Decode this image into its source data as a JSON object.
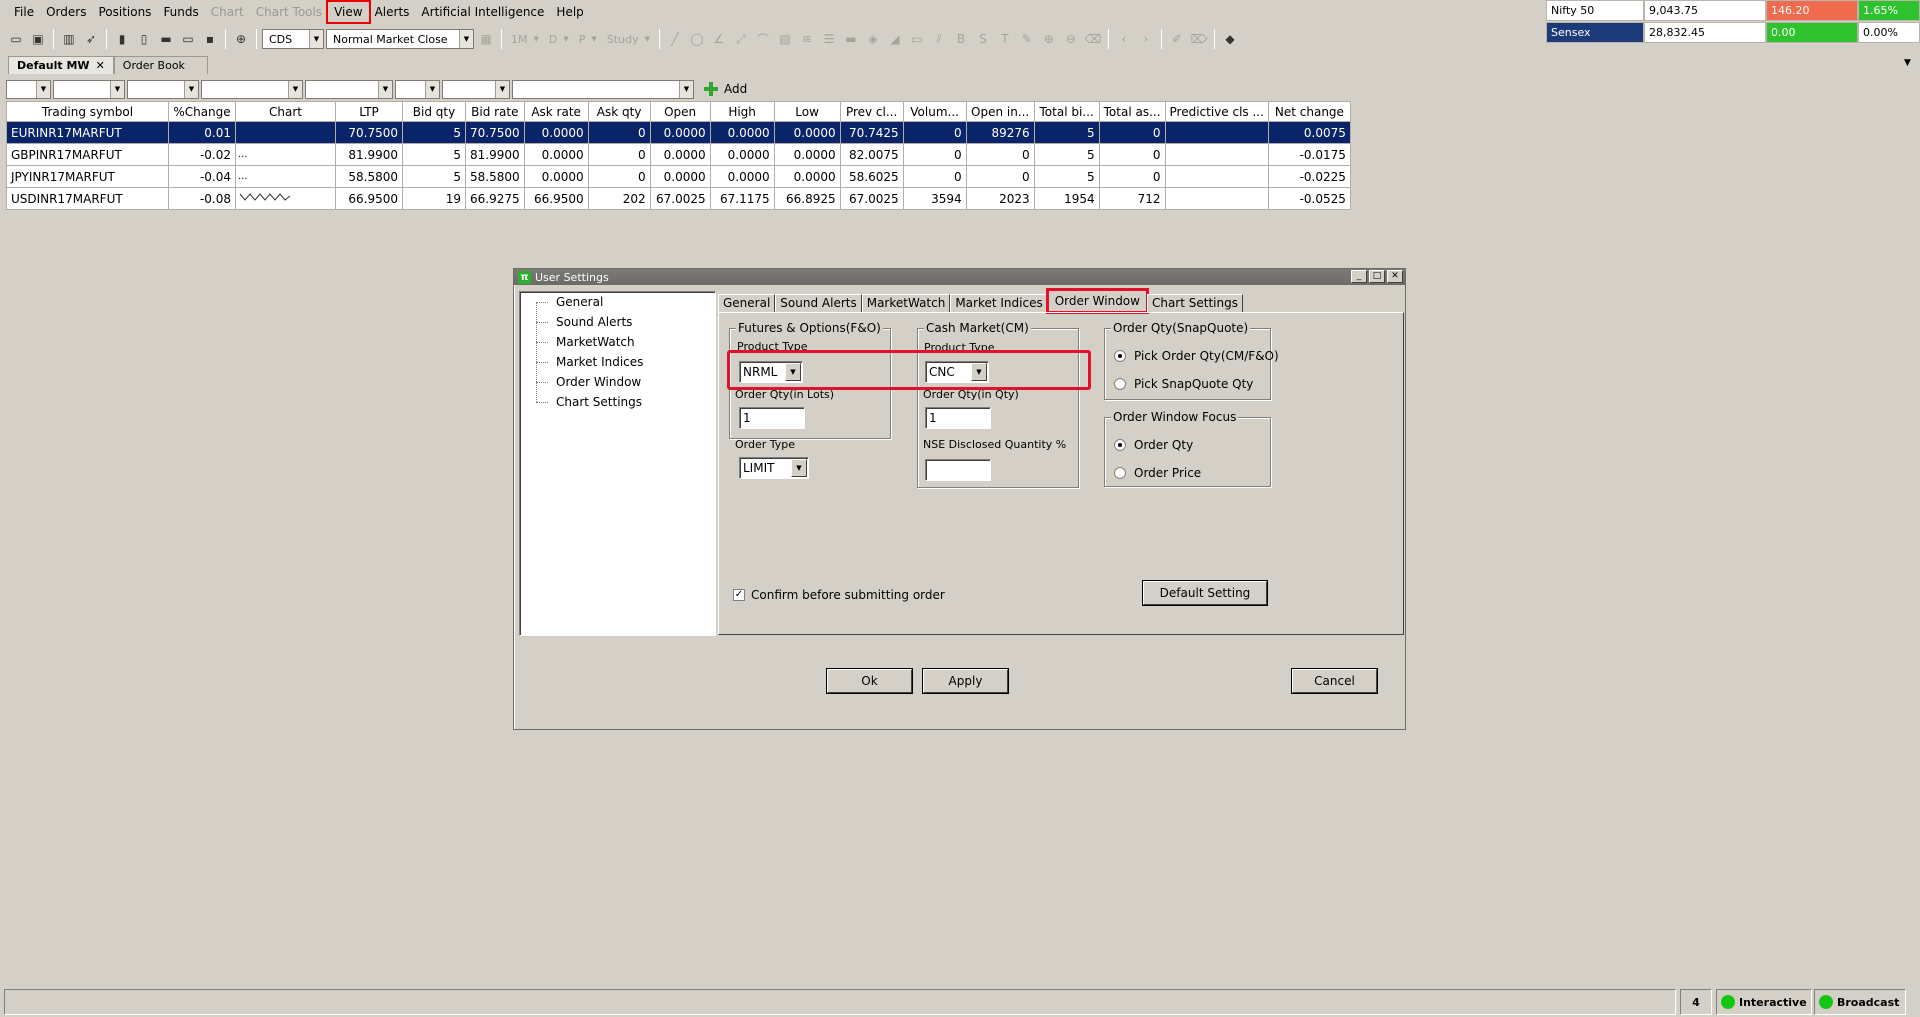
{
  "menu": [
    "File",
    "Orders",
    "Positions",
    "Funds",
    "Chart",
    "Chart Tools",
    "View",
    "Alerts",
    "Artificial Intelligence",
    "Help"
  ],
  "toolbar": {
    "exchange": "CDS",
    "market": "Normal Market Close",
    "interval": "1M",
    "d": "D",
    "p": "P",
    "study": "Study"
  },
  "ticker": [
    {
      "name": "Nifty 50",
      "value": "9,043.75",
      "change": "146.20",
      "pct": "1.65%",
      "change_color": "#f06a4e",
      "pct_color": "#2fc22f"
    },
    {
      "name": "Sensex",
      "value": "28,832.45",
      "change": "0.00",
      "pct": "0.00%",
      "change_color": "#2fc22f",
      "pct_color": "#ffffff"
    }
  ],
  "mw_tabs": [
    "Default MW",
    "Order Book"
  ],
  "add_label": "Add",
  "table": {
    "headers": [
      "Trading symbol",
      "%Change",
      "Chart",
      "LTP",
      "Bid qty",
      "Bid rate",
      "Ask rate",
      "Ask qty",
      "Open",
      "High",
      "Low",
      "Prev cl...",
      "Volum...",
      "Open in...",
      "Total bi...",
      "Total as...",
      "Predictive cls ...",
      "Net change"
    ],
    "rows": [
      [
        "EURINR17MARFUT",
        "0.01",
        "",
        "70.7500",
        "5",
        "70.7500",
        "0.0000",
        "0",
        "0.0000",
        "0.0000",
        "0.0000",
        "70.7425",
        "0",
        "89276",
        "5",
        "0",
        "",
        "0.0075"
      ],
      [
        "GBPINR17MARFUT",
        "-0.02",
        "...",
        "81.9900",
        "5",
        "81.9900",
        "0.0000",
        "0",
        "0.0000",
        "0.0000",
        "0.0000",
        "82.0075",
        "0",
        "0",
        "5",
        "0",
        "",
        "-0.0175"
      ],
      [
        "JPYINR17MARFUT",
        "-0.04",
        "...",
        "58.5800",
        "5",
        "58.5800",
        "0.0000",
        "0",
        "0.0000",
        "0.0000",
        "0.0000",
        "58.6025",
        "0",
        "0",
        "5",
        "0",
        "",
        "-0.0225"
      ],
      [
        "USDINR17MARFUT",
        "-0.08",
        "",
        "66.9500",
        "19",
        "66.9275",
        "66.9500",
        "202",
        "67.0025",
        "67.1175",
        "66.8925",
        "67.0025",
        "3594",
        "2023",
        "1954",
        "712",
        "",
        "-0.0525"
      ]
    ]
  },
  "dialog": {
    "title": "User Settings",
    "tree": [
      "General",
      "Sound Alerts",
      "MarketWatch",
      "Market Indices",
      "Order Window",
      "Chart Settings"
    ],
    "tabs": [
      "General",
      "Sound Alerts",
      "MarketWatch",
      "Market Indices",
      "Order Window",
      "Chart Settings"
    ],
    "fo": {
      "title": "Futures & Options(F&O)",
      "product_type_label": "Product Type",
      "product_type": "NRML",
      "qty_label": "Order Qty(in Lots)",
      "qty": "1",
      "order_type_label": "Order Type",
      "order_type": "LIMIT"
    },
    "cm": {
      "title": "Cash Market(CM)",
      "product_type_label": "Product Type",
      "product_type": "CNC",
      "qty_label": "Order Qty(in Qty)",
      "qty": "1",
      "disclosed_label": "NSE Disclosed Quantity %",
      "disclosed": ""
    },
    "snapquote": {
      "title": "Order Qty(SnapQuote)",
      "options": [
        "Pick Order Qty(CM/F&O)",
        "Pick SnapQuote Qty"
      ]
    },
    "focus": {
      "title": "Order Window Focus",
      "options": [
        "Order Qty",
        "Order Price"
      ]
    },
    "confirm_label": "Confirm before submitting order",
    "default_btn": "Default Setting",
    "ok": "Ok",
    "apply": "Apply",
    "cancel": "Cancel"
  },
  "status": {
    "count": "4",
    "interactive": "Interactive",
    "broadcast": "Broadcast"
  }
}
